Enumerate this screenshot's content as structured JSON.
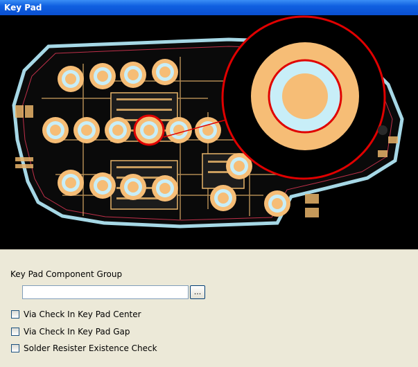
{
  "window": {
    "title": "Key Pad"
  },
  "board": {
    "colors": {
      "background": "#000000",
      "outline": "#a6d8e6",
      "pad": "#f6bd76",
      "highlight": "#e00000",
      "copper": "#e8b46a"
    }
  },
  "form": {
    "group_label": "Key Pad Component Group",
    "group_value": "",
    "browse_label": "...",
    "checks": [
      {
        "label": "Via Check In Key Pad Center",
        "checked": false
      },
      {
        "label": "Via Check In Key Pad Gap",
        "checked": false
      },
      {
        "label": "Solder Resister Existence Check",
        "checked": false
      }
    ]
  }
}
